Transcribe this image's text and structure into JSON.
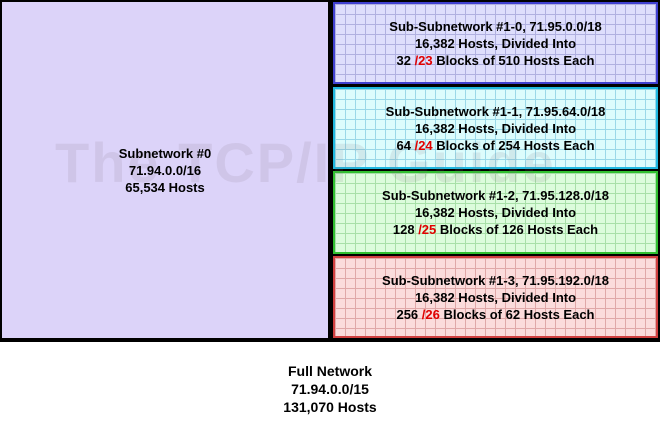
{
  "subnet0": {
    "title": "Subnetwork #0",
    "address": "71.94.0.0/16",
    "hosts": "65,534 Hosts"
  },
  "subnets": [
    {
      "title": "Sub-Subnetwork #1-0, 71.95.0.0/18",
      "hosts": "16,382 Hosts, Divided Into",
      "count": "32",
      "prefix": "/23",
      "rest": "Blocks of 510 Hosts Each",
      "fill": "#dedefc",
      "border": "#4040d0",
      "grid": "#b0b0e0"
    },
    {
      "title": "Sub-Subnetwork #1-1, 71.95.64.0/18",
      "hosts": "16,382 Hosts, Divided Into",
      "count": "64",
      "prefix": "/24",
      "rest": "Blocks of 254 Hosts Each",
      "fill": "#dcfcfc",
      "border": "#20b8e0",
      "grid": "#9ad8e8"
    },
    {
      "title": "Sub-Subnetwork #1-2, 71.95.128.0/18",
      "hosts": "16,382 Hosts, Divided Into",
      "count": "128",
      "prefix": "/25",
      "rest": "Blocks of 126 Hosts Each",
      "fill": "#dcfcdc",
      "border": "#30c030",
      "grid": "#a8e0a8"
    },
    {
      "title": "Sub-Subnetwork #1-3, 71.95.192.0/18",
      "hosts": "16,382 Hosts, Divided Into",
      "count": "256",
      "prefix": "/26",
      "rest": "Blocks of 62 Hosts Each",
      "fill": "#fbdcdc",
      "border": "#d04040",
      "grid": "#e0a8a8"
    }
  ],
  "watermark": "The TCP/IP Guide",
  "full": {
    "title": "Full Network",
    "address": "71.94.0.0/15",
    "hosts": "131,070 Hosts"
  }
}
